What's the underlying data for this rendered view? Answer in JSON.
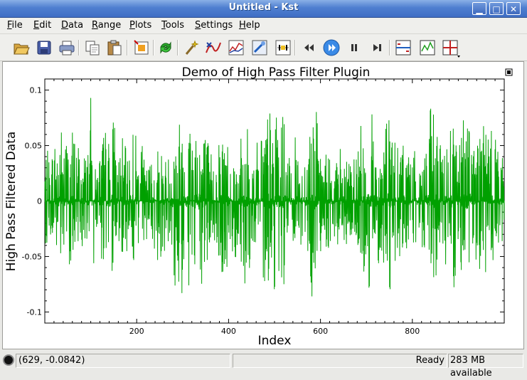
{
  "window": {
    "title": "Untitled - Kst"
  },
  "window_controls": {
    "minimize": "▁",
    "maximize": "□",
    "close": "✕"
  },
  "menu": [
    {
      "label": "File",
      "key": "F",
      "rest": "ile"
    },
    {
      "label": "Edit",
      "key": "E",
      "rest": "dit"
    },
    {
      "label": "Data",
      "key": "D",
      "rest": "ata"
    },
    {
      "label": "Range",
      "key": "R",
      "rest": "ange"
    },
    {
      "label": "Plots",
      "key": "P",
      "rest": "lots"
    },
    {
      "label": "Tools",
      "key": "T",
      "rest": "ools"
    },
    {
      "label": "Settings",
      "key": "S",
      "rest": "ettings"
    },
    {
      "label": "Help",
      "key": "H",
      "rest": "elp"
    }
  ],
  "toolbar": {
    "icons": [
      "open-icon",
      "save-icon",
      "print-icon",
      "copy-icon",
      "paste-icon",
      "data-wizard-icon",
      "reload-icon",
      "wand-icon",
      "plugin-icon",
      "curve-icon",
      "equation-icon",
      "event-monitor-icon",
      "back-icon",
      "play-icon",
      "pause-icon",
      "end-icon",
      "zoom-layout-icon",
      "graph-mode-icon",
      "tie-zoom-icon"
    ]
  },
  "chart_data": {
    "type": "line",
    "title": "Demo of High Pass Filter Plugin",
    "xlabel": "Index",
    "ylabel": "High Pass Filtered Data",
    "xlim": [
      0,
      1000
    ],
    "ylim": [
      -0.11,
      0.11
    ],
    "x_ticks": [
      200,
      400,
      600,
      800
    ],
    "y_ticks": [
      "0.1",
      "0.05",
      "0",
      "-0.05",
      "-0.1"
    ],
    "y_tick_values": [
      0.1,
      0.05,
      0,
      -0.05,
      -0.1
    ],
    "series": [
      {
        "color": "#00a000",
        "envelope_step": 10,
        "envelope_x": [
          0,
          10,
          20,
          30,
          40,
          50,
          60,
          70,
          80,
          90,
          100,
          110,
          120,
          130,
          140,
          150,
          160,
          170,
          180,
          190,
          200,
          210,
          220,
          230,
          240,
          250,
          260,
          270,
          280,
          290,
          300,
          310,
          320,
          330,
          340,
          350,
          360,
          370,
          380,
          390,
          400,
          410,
          420,
          430,
          440,
          450,
          460,
          470,
          480,
          490,
          500,
          510,
          520,
          530,
          540,
          550,
          560,
          570,
          580,
          590,
          600,
          610,
          620,
          630,
          640,
          650,
          660,
          670,
          680,
          690,
          700,
          710,
          720,
          730,
          740,
          750,
          760,
          770,
          780,
          790,
          800,
          810,
          820,
          830,
          840,
          850,
          860,
          870,
          880,
          890,
          900,
          910,
          920,
          930,
          940,
          950,
          960,
          970,
          980,
          990
        ],
        "envelope_max": [
          0.055,
          0.04,
          0.06,
          0.075,
          0.07,
          0.065,
          0.07,
          0.06,
          0.055,
          0.045,
          0.095,
          0.03,
          0.05,
          0.07,
          0.06,
          0.085,
          0.045,
          0.06,
          0.04,
          0.085,
          0.06,
          0.055,
          0.03,
          0.04,
          0.045,
          0.06,
          0.04,
          0.045,
          0.07,
          0.075,
          0.09,
          0.105,
          0.075,
          0.1,
          0.085,
          0.065,
          0.05,
          0.04,
          0.065,
          0.075,
          0.06,
          0.045,
          0.05,
          0.06,
          0.075,
          0.04,
          0.055,
          0.07,
          0.09,
          0.085,
          0.08,
          0.075,
          0.085,
          0.035,
          0.055,
          0.06,
          0.045,
          0.055,
          0.095,
          0.09,
          0.04,
          0.05,
          0.045,
          0.03,
          0.05,
          0.06,
          0.035,
          0.035,
          0.065,
          0.07,
          0.095,
          0.085,
          0.07,
          0.045,
          0.075,
          0.09,
          0.06,
          0.045,
          0.065,
          0.055,
          0.04,
          0.05,
          0.045,
          0.065,
          0.085,
          0.09,
          0.05,
          0.055,
          0.08,
          0.095,
          0.05,
          0.08,
          0.1,
          0.075,
          0.065,
          0.09,
          0.08,
          0.055,
          0.1,
          0.04
        ],
        "envelope_min": [
          -0.04,
          -0.035,
          -0.05,
          -0.065,
          -0.07,
          -0.06,
          -0.055,
          -0.045,
          -0.04,
          -0.055,
          -0.1,
          -0.035,
          -0.05,
          -0.06,
          -0.065,
          -0.065,
          -0.04,
          -0.05,
          -0.045,
          -0.06,
          -0.055,
          -0.05,
          -0.035,
          -0.04,
          -0.05,
          -0.06,
          -0.045,
          -0.055,
          -0.09,
          -0.085,
          -0.1,
          -0.085,
          -0.08,
          -0.1,
          -0.095,
          -0.07,
          -0.05,
          -0.045,
          -0.06,
          -0.085,
          -0.065,
          -0.05,
          -0.06,
          -0.07,
          -0.08,
          -0.045,
          -0.05,
          -0.065,
          -0.075,
          -0.09,
          -0.08,
          -0.075,
          -0.08,
          -0.04,
          -0.05,
          -0.055,
          -0.04,
          -0.06,
          -0.085,
          -0.095,
          -0.045,
          -0.05,
          -0.04,
          -0.035,
          -0.045,
          -0.05,
          -0.04,
          -0.035,
          -0.06,
          -0.065,
          -0.085,
          -0.08,
          -0.07,
          -0.05,
          -0.07,
          -0.085,
          -0.06,
          -0.05,
          -0.06,
          -0.05,
          -0.045,
          -0.045,
          -0.05,
          -0.06,
          -0.08,
          -0.09,
          -0.05,
          -0.055,
          -0.07,
          -0.09,
          -0.05,
          -0.075,
          -0.095,
          -0.07,
          -0.065,
          -0.08,
          -0.075,
          -0.055,
          -0.09,
          -0.045
        ]
      }
    ]
  },
  "status": {
    "coords": "(629, -0.0842)",
    "ready": "Ready",
    "memory": "283 MB available"
  }
}
